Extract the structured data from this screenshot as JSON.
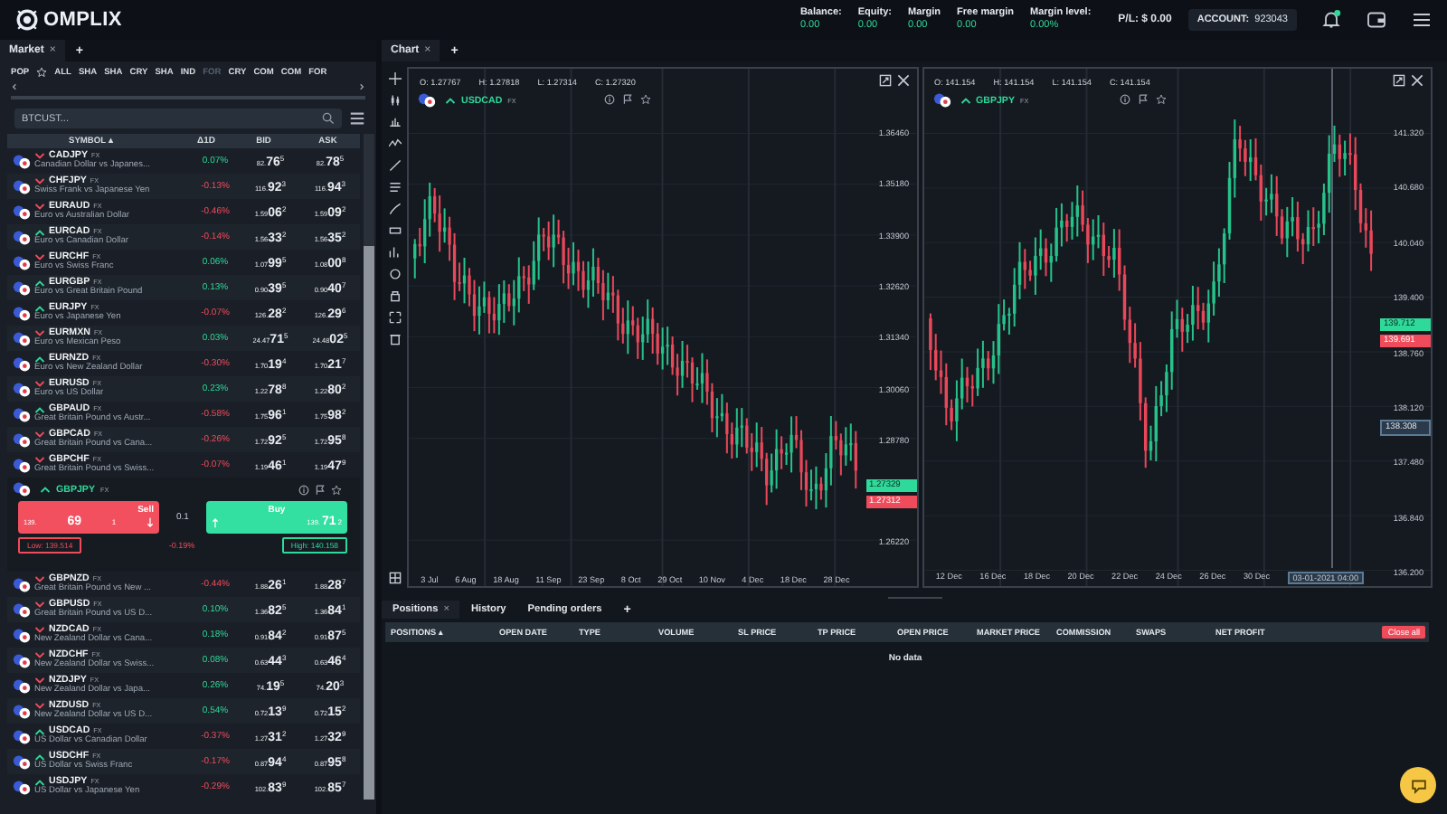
{
  "header": {
    "logo": "OMPLIX",
    "stats": [
      {
        "label": "Balance:",
        "value": "0.00"
      },
      {
        "label": "Equity:",
        "value": "0.00"
      },
      {
        "label": "Margin",
        "value": "0.00"
      },
      {
        "label": "Free margin",
        "value": "0.00"
      },
      {
        "label": "Margin level:",
        "value": "0.00%"
      }
    ],
    "pl": "P/L: $ 0.00",
    "account_label": "ACCOUNT:",
    "account": "923043",
    "notification": true
  },
  "market": {
    "tab": "Market",
    "close": "×",
    "add": "+",
    "filters": [
      {
        "kind": "text",
        "label": "POP",
        "selected": false
      },
      {
        "kind": "favorites",
        "selected": false
      },
      {
        "kind": "text",
        "label": "ALL",
        "selected": false
      },
      {
        "kind": "text",
        "label": "SHA",
        "selected": false
      },
      {
        "kind": "text",
        "label": "SHA",
        "selected": false
      },
      {
        "kind": "text",
        "label": "CRY",
        "selected": false
      },
      {
        "kind": "text",
        "label": "SHA",
        "selected": false
      },
      {
        "kind": "text",
        "label": "IND",
        "selected": false
      },
      {
        "kind": "text",
        "label": "FOR",
        "selected": true
      },
      {
        "kind": "text",
        "label": "CRY",
        "selected": false
      },
      {
        "kind": "text",
        "label": "COM",
        "selected": false
      },
      {
        "kind": "text",
        "label": "COM",
        "selected": false
      },
      {
        "kind": "text",
        "label": "FOR",
        "selected": false
      }
    ],
    "search": {
      "placeholder": "BTCUST..."
    },
    "columns": [
      "SYMBOL ▴",
      "Δ1D",
      "BID",
      "ASK"
    ],
    "rows": [
      {
        "symbol": "CADJPY",
        "tag": "FX",
        "description": "Canadian Dollar vs Japanes...",
        "rising": false,
        "change": "0.07%",
        "change_negative": false,
        "bid": [
          "82.",
          "76",
          "5"
        ],
        "ask": [
          "82.",
          "78",
          "5"
        ],
        "expanded": false
      },
      {
        "symbol": "CHFJPY",
        "tag": "FX",
        "description": "Swiss Frank vs Japanese Yen",
        "rising": false,
        "change": "-0.13%",
        "change_negative": true,
        "bid": [
          "116.",
          "92",
          "3"
        ],
        "ask": [
          "116.",
          "94",
          "3"
        ],
        "expanded": false
      },
      {
        "symbol": "EURAUD",
        "tag": "FX",
        "description": "Euro vs Australian Dollar",
        "rising": false,
        "change": "-0.46%",
        "change_negative": true,
        "bid": [
          "1.59",
          "06",
          "2"
        ],
        "ask": [
          "1.59",
          "09",
          "2"
        ],
        "expanded": false
      },
      {
        "symbol": "EURCAD",
        "tag": "FX",
        "description": "Euro vs Canadian Dollar",
        "rising": true,
        "change": "-0.14%",
        "change_negative": true,
        "bid": [
          "1.56",
          "33",
          "2"
        ],
        "ask": [
          "1.56",
          "35",
          "2"
        ],
        "expanded": false
      },
      {
        "symbol": "EURCHF",
        "tag": "FX",
        "description": "Euro vs Swiss Franc",
        "rising": false,
        "change": "0.06%",
        "change_negative": false,
        "bid": [
          "1.07",
          "99",
          "5"
        ],
        "ask": [
          "1.08",
          "00",
          "8"
        ],
        "expanded": false
      },
      {
        "symbol": "EURGBP",
        "tag": "FX",
        "description": "Euro vs Great Britain Pound",
        "rising": true,
        "change": "0.13%",
        "change_negative": false,
        "bid": [
          "0.90",
          "39",
          "5"
        ],
        "ask": [
          "0.90",
          "40",
          "7"
        ],
        "expanded": false
      },
      {
        "symbol": "EURJPY",
        "tag": "FX",
        "description": "Euro vs Japanese Yen",
        "rising": true,
        "change": "-0.07%",
        "change_negative": true,
        "bid": [
          "126.",
          "28",
          "2"
        ],
        "ask": [
          "126.",
          "29",
          "6"
        ],
        "expanded": false
      },
      {
        "symbol": "EURMXN",
        "tag": "FX",
        "description": "Euro vs Mexican Peso",
        "rising": false,
        "change": "0.03%",
        "change_negative": false,
        "bid": [
          "24.47",
          "71",
          "5"
        ],
        "ask": [
          "24.48",
          "02",
          "5"
        ],
        "expanded": false
      },
      {
        "symbol": "EURNZD",
        "tag": "FX",
        "description": "Euro vs New Zealand Dollar",
        "rising": true,
        "change": "-0.30%",
        "change_negative": true,
        "bid": [
          "1.70",
          "19",
          "4"
        ],
        "ask": [
          "1.70",
          "21",
          "7"
        ],
        "expanded": false
      },
      {
        "symbol": "EURUSD",
        "tag": "FX",
        "description": "Euro vs US Dollar",
        "rising": false,
        "change": "0.23%",
        "change_negative": false,
        "bid": [
          "1.22",
          "78",
          "8"
        ],
        "ask": [
          "1.22",
          "80",
          "2"
        ],
        "expanded": false
      },
      {
        "symbol": "GBPAUD",
        "tag": "FX",
        "description": "Great Britain Pound vs Austr...",
        "rising": true,
        "change": "-0.58%",
        "change_negative": true,
        "bid": [
          "1.75",
          "96",
          "1"
        ],
        "ask": [
          "1.75",
          "98",
          "2"
        ],
        "expanded": false
      },
      {
        "symbol": "GBPCAD",
        "tag": "FX",
        "description": "Great Britain Pound vs Cana...",
        "rising": false,
        "change": "-0.26%",
        "change_negative": true,
        "bid": [
          "1.72",
          "92",
          "5"
        ],
        "ask": [
          "1.72",
          "95",
          "8"
        ],
        "expanded": false
      },
      {
        "symbol": "GBPCHF",
        "tag": "FX",
        "description": "Great Britain Pound vs Swiss...",
        "rising": false,
        "change": "-0.07%",
        "change_negative": true,
        "bid": [
          "1.19",
          "46",
          "1"
        ],
        "ask": [
          "1.19",
          "47",
          "9"
        ],
        "expanded": false
      },
      {
        "symbol": "GBPJPY",
        "tag": "FX",
        "rising": true,
        "expanded": true,
        "sell_label": "Sell",
        "sell": [
          "139.",
          "69",
          "1"
        ],
        "buy_label": "Buy",
        "buy": [
          "139.",
          "71",
          "2"
        ],
        "spread": "0.1",
        "low": "Low: 139.514",
        "high": "High: 140.158",
        "change": "-0.19%",
        "change_negative": true
      },
      {
        "symbol": "GBPNZD",
        "tag": "FX",
        "description": "Great Britain Pound vs New ...",
        "rising": false,
        "change": "-0.44%",
        "change_negative": true,
        "bid": [
          "1.88",
          "26",
          "1"
        ],
        "ask": [
          "1.88",
          "28",
          "7"
        ],
        "expanded": false
      },
      {
        "symbol": "GBPUSD",
        "tag": "FX",
        "description": "Great Britain Pound vs US D...",
        "rising": false,
        "change": "0.10%",
        "change_negative": false,
        "bid": [
          "1.36",
          "82",
          "5"
        ],
        "ask": [
          "1.36",
          "84",
          "1"
        ],
        "expanded": false
      },
      {
        "symbol": "NZDCAD",
        "tag": "FX",
        "description": "New Zealand Dollar vs Cana...",
        "rising": false,
        "change": "0.18%",
        "change_negative": false,
        "bid": [
          "0.91",
          "84",
          "2"
        ],
        "ask": [
          "0.91",
          "87",
          "5"
        ],
        "expanded": false
      },
      {
        "symbol": "NZDCHF",
        "tag": "FX",
        "description": "New Zealand Dollar vs Swiss...",
        "rising": false,
        "change": "0.08%",
        "change_negative": false,
        "bid": [
          "0.63",
          "44",
          "3"
        ],
        "ask": [
          "0.63",
          "46",
          "4"
        ],
        "expanded": false
      },
      {
        "symbol": "NZDJPY",
        "tag": "FX",
        "description": "New Zealand Dollar vs Japa...",
        "rising": false,
        "change": "0.26%",
        "change_negative": false,
        "bid": [
          "74.",
          "19",
          "5"
        ],
        "ask": [
          "74.",
          "20",
          "3"
        ],
        "expanded": false
      },
      {
        "symbol": "NZDUSD",
        "tag": "FX",
        "description": "New Zealand Dollar vs US D...",
        "rising": false,
        "change": "0.54%",
        "change_negative": false,
        "bid": [
          "0.72",
          "13",
          "9"
        ],
        "ask": [
          "0.72",
          "15",
          "2"
        ],
        "expanded": false
      },
      {
        "symbol": "USDCAD",
        "tag": "FX",
        "description": "US Dollar vs Canadian Dollar",
        "rising": true,
        "change": "-0.37%",
        "change_negative": true,
        "bid": [
          "1.27",
          "31",
          "2"
        ],
        "ask": [
          "1.27",
          "32",
          "9"
        ],
        "expanded": false
      },
      {
        "symbol": "USDCHF",
        "tag": "FX",
        "description": "US Dollar vs Swiss Franc",
        "rising": true,
        "change": "-0.17%",
        "change_negative": true,
        "bid": [
          "0.87",
          "94",
          "4"
        ],
        "ask": [
          "0.87",
          "95",
          "8"
        ],
        "expanded": false
      },
      {
        "symbol": "USDJPY",
        "tag": "FX",
        "description": "US Dollar vs Japanese Yen",
        "rising": true,
        "change": "-0.29%",
        "change_negative": true,
        "bid": [
          "102.",
          "83",
          "9"
        ],
        "ask": [
          "102.",
          "85",
          "7"
        ],
        "expanded": false
      }
    ]
  },
  "chart_panel": {
    "tab": "Chart",
    "close": "×",
    "add": "+",
    "charts": [
      {
        "ohlc": [
          "O: 1.27767",
          "H: 1.27818",
          "L: 1.27314",
          "C: 1.27320"
        ],
        "symbol": "USDCAD",
        "tag": "FX",
        "rising": true,
        "y_ticks": [
          "1.36460",
          "1.35180",
          "1.33900",
          "1.32620",
          "1.31340",
          "1.30060",
          "1.28780",
          "1.26220"
        ],
        "ask_tag": "1.27329",
        "bid_tag": "1.27312",
        "x_labels": [
          "3 Jul",
          "6 Aug",
          "18 Aug",
          "11 Sep",
          "23 Sep",
          "8 Oct",
          "29 Oct",
          "10 Nov",
          "4 Dec",
          "18 Dec",
          "28 Dec"
        ]
      },
      {
        "ohlc": [
          "O: 141.154",
          "H: 141.154",
          "L: 141.154",
          "C: 141.154"
        ],
        "symbol": "GBPJPY",
        "tag": "FX",
        "rising": true,
        "y_ticks": [
          "141.320",
          "140.680",
          "140.040",
          "139.400",
          "138.760",
          "138.120",
          "137.480",
          "136.840",
          "136.200"
        ],
        "ask_tag": "139.712",
        "bid_tag": "139.691",
        "crosshair_price": "138.308",
        "crosshair_time": "03-01-2021 04:00",
        "x_labels": [
          "12 Dec",
          "16 Dec",
          "18 Dec",
          "20 Dec",
          "22 Dec",
          "24 Dec",
          "26 Dec",
          "30 Dec"
        ]
      }
    ]
  },
  "positions": {
    "tabs": [
      {
        "label": "Positions",
        "selected": true,
        "closable": true
      },
      {
        "label": "History",
        "selected": false,
        "closable": false
      },
      {
        "label": "Pending orders",
        "selected": false,
        "closable": false
      }
    ],
    "add": "+",
    "close": "×",
    "columns": [
      "POSITIONS ▴",
      "OPEN DATE",
      "TYPE",
      "VOLUME",
      "SL PRICE",
      "TP PRICE",
      "OPEN PRICE",
      "MARKET PRICE",
      "COMMISSION",
      "SWAPS",
      "NET PROFIT"
    ],
    "close_all": "Close all",
    "empty": "No data"
  }
}
